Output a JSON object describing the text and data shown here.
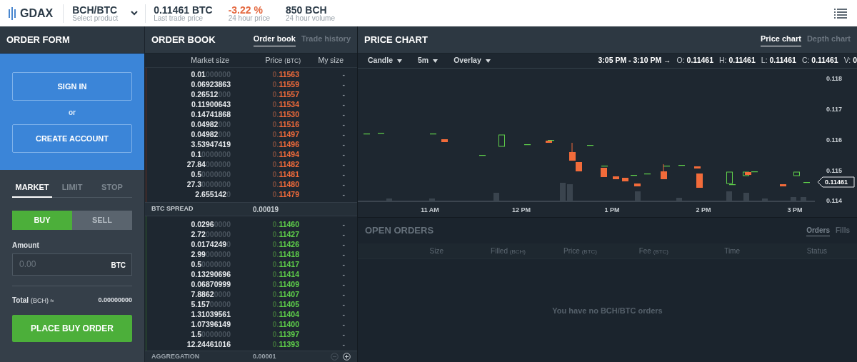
{
  "header": {
    "logo": "GDAX",
    "product": {
      "name": "BCH/BTC",
      "hint": "Select product"
    },
    "stats": [
      {
        "value": "0.11461 BTC",
        "label": "Last trade price",
        "kind": "neutral"
      },
      {
        "value": "-3.22 %",
        "label": "24 hour price",
        "kind": "negative"
      },
      {
        "value": "850 BCH",
        "label": "24 hour volume",
        "kind": "neutral"
      }
    ]
  },
  "order_form": {
    "title": "ORDER FORM",
    "sign_in": "SIGN IN",
    "or": "or",
    "create_account": "CREATE ACCOUNT",
    "order_types": [
      {
        "label": "MARKET",
        "selected": true
      },
      {
        "label": "LIMIT",
        "selected": false
      },
      {
        "label": "STOP",
        "selected": false
      }
    ],
    "sides": [
      {
        "label": "BUY",
        "selected": true
      },
      {
        "label": "SELL",
        "selected": false
      }
    ],
    "amount_label": "Amount",
    "amount_placeholder": "0.00",
    "amount_unit": "BTC",
    "total_label": "Total",
    "total_unit": "(BCH) ≈",
    "total_value": "0.00000000",
    "submit": "PLACE BUY ORDER"
  },
  "order_book": {
    "title": "ORDER BOOK",
    "tabs": [
      {
        "label": "Order book",
        "selected": true
      },
      {
        "label": "Trade history",
        "selected": false
      }
    ],
    "columns": [
      {
        "label": "Market size"
      },
      {
        "label": "Price",
        "unit": "(BTC)"
      },
      {
        "label": "My size"
      }
    ],
    "asks": [
      {
        "size": "0.01",
        "pad": "000000",
        "lead": "0.",
        "price": "11563",
        "mine": "-"
      },
      {
        "size": "0.06923863",
        "lead": "0.",
        "price": "11559",
        "mine": "-"
      },
      {
        "size": "0.26512",
        "pad": "000",
        "lead": "0.",
        "price": "11557",
        "mine": "-"
      },
      {
        "size": "0.11900643",
        "lead": "0.",
        "price": "11534",
        "mine": "-"
      },
      {
        "size": "0.14741868",
        "lead": "0.",
        "price": "11530",
        "mine": "-"
      },
      {
        "size": "0.04982",
        "pad": "000",
        "lead": "0.",
        "price": "11516",
        "mine": "-"
      },
      {
        "size": "0.04982",
        "pad": "000",
        "lead": "0.",
        "price": "11497",
        "mine": "-"
      },
      {
        "size": "3.53947419",
        "lead": "0.",
        "price": "11496",
        "mine": "-"
      },
      {
        "size": "0.1",
        "pad": "0000000",
        "lead": "0.",
        "price": "11494",
        "mine": "-"
      },
      {
        "size": "27.84",
        "pad": "000000",
        "lead": "0.",
        "price": "11482",
        "mine": "-"
      },
      {
        "size": "0.5",
        "pad": "0000000",
        "lead": "0.",
        "price": "11481",
        "mine": "-"
      },
      {
        "size": "27.3",
        "pad": "0000000",
        "lead": "0.",
        "price": "11480",
        "mine": "-"
      },
      {
        "size": "2.655142",
        "pad": "0",
        "lead": "0.",
        "price": "11479",
        "mine": "-"
      }
    ],
    "spread_label": "BTC SPREAD",
    "spread_value": "0.00019",
    "bids": [
      {
        "size": "0.0296",
        "pad": "0000",
        "lead": "0.",
        "price": "11460",
        "mine": "-"
      },
      {
        "size": "2.72",
        "pad": "000000",
        "lead": "0.",
        "price": "11427",
        "mine": "-"
      },
      {
        "size": "0.0174249",
        "pad": "0",
        "lead": "0.",
        "price": "11426",
        "mine": "-"
      },
      {
        "size": "2.99",
        "pad": "000000",
        "lead": "0.",
        "price": "11418",
        "mine": "-"
      },
      {
        "size": "0.5",
        "pad": "0000000",
        "lead": "0.",
        "price": "11417",
        "mine": "-"
      },
      {
        "size": "0.13290696",
        "lead": "0.",
        "price": "11414",
        "mine": "-"
      },
      {
        "size": "0.06870999",
        "lead": "0.",
        "price": "11409",
        "mine": "-"
      },
      {
        "size": "7.8862",
        "pad": "0000",
        "lead": "0.",
        "price": "11407",
        "mine": "-"
      },
      {
        "size": "5.157",
        "pad": "00000",
        "lead": "0.",
        "price": "11405",
        "mine": "-"
      },
      {
        "size": "1.31039561",
        "lead": "0.",
        "price": "11404",
        "mine": "-"
      },
      {
        "size": "1.07396149",
        "lead": "0.",
        "price": "11400",
        "mine": "-"
      },
      {
        "size": "1.5",
        "pad": "0000000",
        "lead": "0.",
        "price": "11397",
        "mine": "-"
      },
      {
        "size": "12.24461016",
        "lead": "0.",
        "price": "11393",
        "mine": "-"
      }
    ],
    "aggregation_label": "AGGREGATION",
    "aggregation_value": "0.00001"
  },
  "price_chart": {
    "title": "PRICE CHART",
    "tabs": [
      {
        "label": "Price chart",
        "selected": true
      },
      {
        "label": "Depth chart",
        "selected": false
      }
    ],
    "controls": [
      "Candle",
      "5m",
      "Overlay"
    ],
    "range": "3:05 PM - 3:10 PM →",
    "ohlc": [
      {
        "label": "O:",
        "value": "0.11461"
      },
      {
        "label": "H:",
        "value": "0.11461"
      },
      {
        "label": "L:",
        "value": "0.11461"
      },
      {
        "label": "C:",
        "value": "0.11461"
      },
      {
        "label": "V:",
        "value": "0"
      }
    ],
    "y_ticks": [
      "0.118",
      "0.117",
      "0.116",
      "0.115",
      "0.114"
    ],
    "x_ticks": [
      "11 AM",
      "12 PM",
      "1 PM",
      "2 PM",
      "3 PM"
    ],
    "last_price": "0.11461"
  },
  "open_orders": {
    "title": "OPEN ORDERS",
    "tabs": [
      {
        "label": "Orders",
        "selected": true
      },
      {
        "label": "Fills",
        "selected": false
      }
    ],
    "columns": [
      {
        "label": "Size"
      },
      {
        "label": "Filled",
        "unit": "(BCH)"
      },
      {
        "label": "Price",
        "unit": "(BTC)"
      },
      {
        "label": "Fee",
        "unit": "(BTC)"
      },
      {
        "label": "Time"
      },
      {
        "label": "Status"
      }
    ],
    "empty": "You have no BCH/BTC orders"
  }
}
